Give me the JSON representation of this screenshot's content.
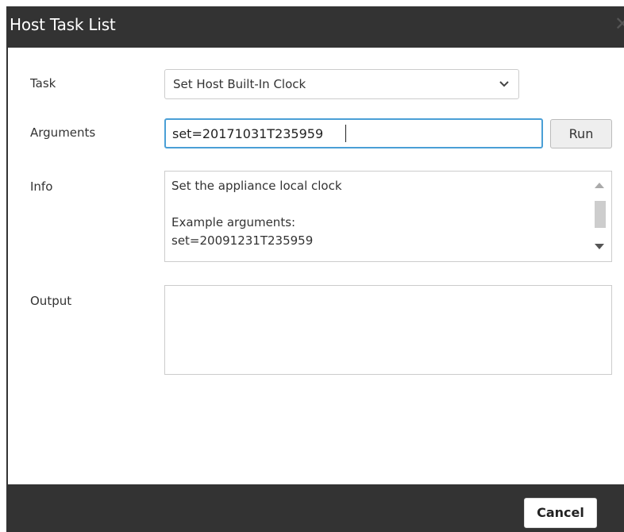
{
  "dialog": {
    "title": "Host Task List",
    "close_icon": "close-icon"
  },
  "form": {
    "task_label": "Task",
    "task_value": "Set Host Built-In Clock",
    "arguments_label": "Arguments",
    "arguments_value": "set=20171031T235959",
    "run_label": "Run",
    "info_label": "Info",
    "info_text": "Set the appliance local clock\n\nExample arguments:\nset=20091231T235959",
    "output_label": "Output",
    "output_value": ""
  },
  "footer": {
    "cancel_label": "Cancel"
  }
}
